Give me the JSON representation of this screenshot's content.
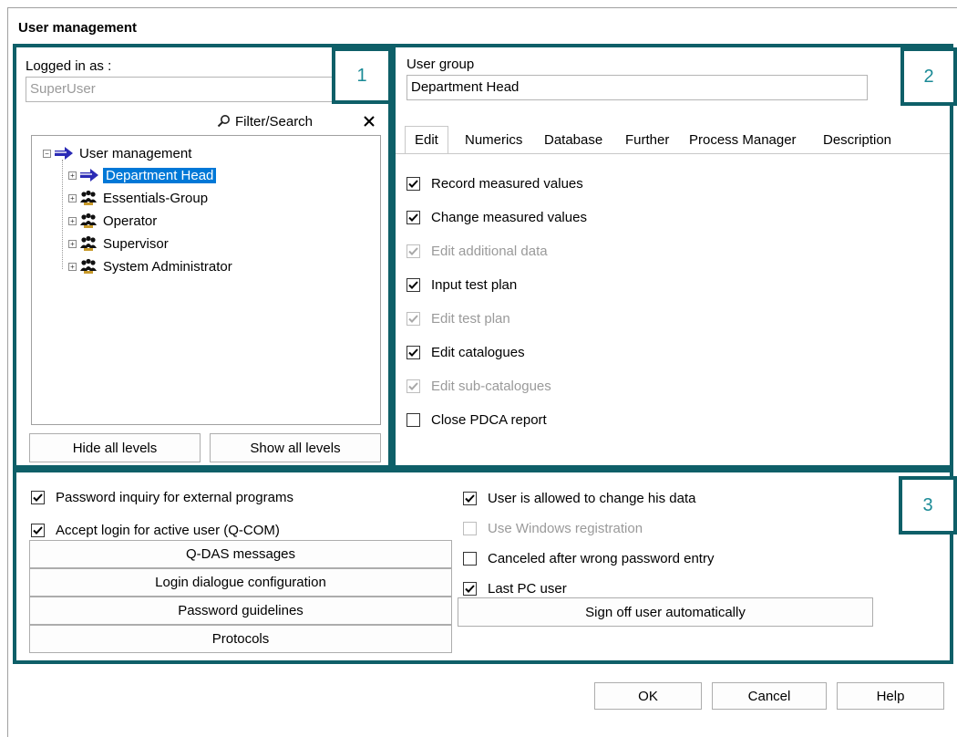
{
  "window": {
    "title": "User management"
  },
  "callouts": [
    "1",
    "2",
    "3"
  ],
  "left_panel": {
    "logged_in_label": "Logged in as :",
    "logged_in_value": "SuperUser",
    "filter_search_label": "Filter/Search",
    "tree": {
      "root": "User management",
      "groups": [
        {
          "label": "Department Head",
          "selected": true
        },
        {
          "label": "Essentials-Group",
          "selected": false
        },
        {
          "label": "Operator",
          "selected": false
        },
        {
          "label": "Supervisor",
          "selected": false
        },
        {
          "label": "System Administrator",
          "selected": false
        }
      ]
    },
    "hide_levels_label": "Hide all levels",
    "show_levels_label": "Show all levels"
  },
  "right_panel": {
    "user_group_label": "User group",
    "user_group_value": "Department Head",
    "tabs": [
      "Edit",
      "Numerics",
      "Database",
      "Further",
      "Process Manager",
      "Description"
    ],
    "active_tab": "Edit",
    "permissions": [
      {
        "label": "Record measured values",
        "checked": true,
        "enabled": true
      },
      {
        "label": "Change measured values",
        "checked": true,
        "enabled": true
      },
      {
        "label": "Edit additional data",
        "checked": true,
        "enabled": false
      },
      {
        "label": "Input test plan",
        "checked": true,
        "enabled": true
      },
      {
        "label": "Edit test plan",
        "checked": true,
        "enabled": false
      },
      {
        "label": "Edit catalogues",
        "checked": true,
        "enabled": true
      },
      {
        "label": "Edit sub-catalogues",
        "checked": true,
        "enabled": false
      },
      {
        "label": "Close PDCA report",
        "checked": false,
        "enabled": true
      }
    ]
  },
  "bottom_panel": {
    "left_checks": [
      {
        "label": "Password inquiry for external programs",
        "checked": true,
        "enabled": true
      },
      {
        "label": "Accept login for active user (Q-COM)",
        "checked": true,
        "enabled": true
      }
    ],
    "buttons": [
      "Q-DAS messages",
      "Login dialogue configuration",
      "Password guidelines",
      "Protocols"
    ],
    "right_checks": [
      {
        "label": "User is allowed to change his data",
        "checked": true,
        "enabled": true
      },
      {
        "label": "Use Windows registration",
        "checked": false,
        "enabled": false
      },
      {
        "label": "Canceled after wrong password entry",
        "checked": false,
        "enabled": true
      },
      {
        "label": "Last PC user",
        "checked": true,
        "enabled": true
      }
    ],
    "sign_off_label": "Sign off user automatically"
  },
  "footer": {
    "ok_label": "OK",
    "cancel_label": "Cancel",
    "help_label": "Help"
  },
  "colors": {
    "callout_border": "#0e5f68",
    "callout_number": "#1a8a96",
    "selection": "#0078d7"
  }
}
